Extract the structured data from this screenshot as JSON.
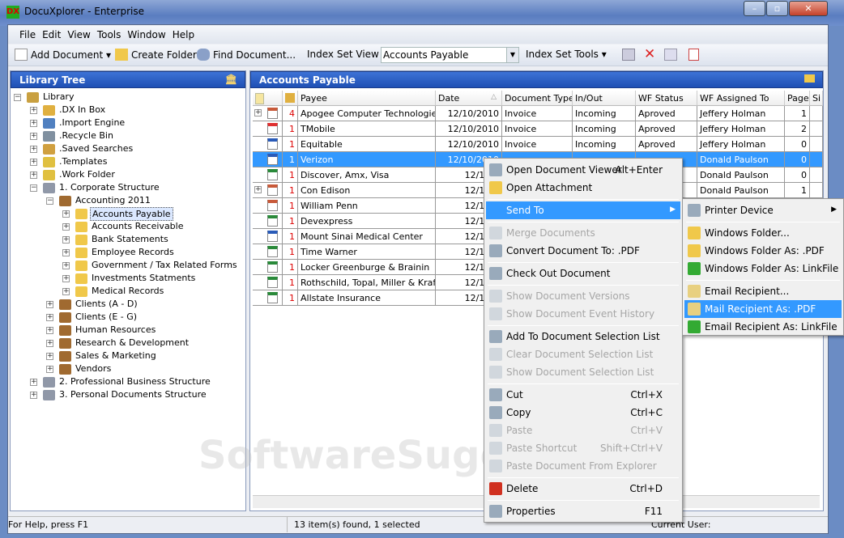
{
  "window": {
    "title": "DocuXplorer - Enterprise",
    "logo": "DX",
    "controls": [
      "–",
      "▫",
      "✕"
    ]
  },
  "menubar": [
    "File",
    "Edit",
    "View",
    "Tools",
    "Window",
    "Help"
  ],
  "toolbar": {
    "add_document": "Add Document",
    "create_folder": "Create Folder",
    "find_document": "Find Document...",
    "index_set_view_label": "Index Set View",
    "index_set_view_value": "Accounts Payable",
    "index_set_tools": "Index Set Tools"
  },
  "library_tree": {
    "title": "Library Tree",
    "items": [
      {
        "label": "Library",
        "level": 0,
        "icon": "library"
      },
      {
        "label": ".DX In Box",
        "level": 1,
        "icon": "inbox"
      },
      {
        "label": ".Import Engine",
        "level": 1,
        "icon": "gear"
      },
      {
        "label": ".Recycle Bin",
        "level": 1,
        "icon": "bin"
      },
      {
        "label": ".Saved Searches",
        "level": 1,
        "icon": "search"
      },
      {
        "label": ".Templates",
        "level": 1,
        "icon": "template"
      },
      {
        "label": ".Work Folder",
        "level": 1,
        "icon": "work"
      },
      {
        "label": "1. Corporate Structure",
        "level": 1,
        "icon": "cabinet",
        "open": true
      },
      {
        "label": "Accounting 2011",
        "level": 2,
        "icon": "drawer",
        "open": true
      },
      {
        "label": "Accounts Payable",
        "level": 3,
        "icon": "folder",
        "selected": true
      },
      {
        "label": "Accounts Receivable",
        "level": 3,
        "icon": "folder"
      },
      {
        "label": "Bank Statements",
        "level": 3,
        "icon": "folder"
      },
      {
        "label": "Employee Records",
        "level": 3,
        "icon": "folder"
      },
      {
        "label": "Government / Tax Related Forms",
        "level": 3,
        "icon": "folder"
      },
      {
        "label": "Investments Statments",
        "level": 3,
        "icon": "folder"
      },
      {
        "label": "Medical Records",
        "level": 3,
        "icon": "folder"
      },
      {
        "label": "Clients (A - D)",
        "level": 2,
        "icon": "drawer"
      },
      {
        "label": "Clients (E - G)",
        "level": 2,
        "icon": "drawer"
      },
      {
        "label": "Human Resources",
        "level": 2,
        "icon": "drawer"
      },
      {
        "label": "Research & Development",
        "level": 2,
        "icon": "drawer"
      },
      {
        "label": "Sales & Marketing",
        "level": 2,
        "icon": "drawer"
      },
      {
        "label": "Vendors",
        "level": 2,
        "icon": "drawer"
      },
      {
        "label": "2. Professional Business Structure",
        "level": 1,
        "icon": "cabinet"
      },
      {
        "label": "3. Personal Documents Structure",
        "level": 1,
        "icon": "cabinet"
      }
    ]
  },
  "documents": {
    "title": "Accounts Payable",
    "columns": [
      "Payee",
      "Date",
      "Document Type",
      "In/Out",
      "WF Status",
      "WF Assigned To",
      "Page",
      "Si"
    ],
    "rows": [
      {
        "type": "img",
        "exp": true,
        "count": "4",
        "payee": "Apogee Computer Technologies",
        "date": "12/10/2010",
        "doctype": "Invoice",
        "inout": "Incoming",
        "status": "Aproved",
        "assigned": "Jeffery Holman",
        "page": "1"
      },
      {
        "type": "pdf",
        "count": "1",
        "payee": "TMobile",
        "date": "12/10/2010",
        "doctype": "Invoice",
        "inout": "Incoming",
        "status": "Aproved",
        "assigned": "Jeffery Holman",
        "page": "2"
      },
      {
        "type": "word",
        "count": "1",
        "payee": "Equitable",
        "date": "12/10/2010",
        "doctype": "Invoice",
        "inout": "Incoming",
        "status": "Aproved",
        "assigned": "Jeffery Holman",
        "page": "0"
      },
      {
        "type": "word",
        "count": "1",
        "payee": "Verizon",
        "date": "12/10/2010",
        "doctype": "",
        "inout": "",
        "status": "",
        "assigned": "Donald Paulson",
        "page": "0",
        "selected": true
      },
      {
        "type": "excel",
        "count": "1",
        "payee": "Discover, Amx, Visa",
        "date": "12/10/2",
        "doctype": "",
        "inout": "",
        "status": "",
        "assigned": "Donald Paulson",
        "page": "0"
      },
      {
        "type": "img",
        "exp": true,
        "count": "1",
        "payee": "Con Edison",
        "date": "12/10/2",
        "doctype": "",
        "inout": "",
        "status": "",
        "assigned": "Donald Paulson",
        "page": "1"
      },
      {
        "type": "img",
        "count": "1",
        "payee": "William Penn",
        "date": "12/10/2",
        "doctype": "",
        "inout": "",
        "status": "",
        "assigned": "",
        "page": ""
      },
      {
        "type": "excel",
        "count": "1",
        "payee": "Devexpress",
        "date": "12/10/2",
        "doctype": "",
        "inout": "",
        "status": "",
        "assigned": "",
        "page": ""
      },
      {
        "type": "word",
        "count": "1",
        "payee": "Mount Sinai Medical Center",
        "date": "12/10/2",
        "doctype": "",
        "inout": "",
        "status": "",
        "assigned": "",
        "page": ""
      },
      {
        "type": "excel",
        "count": "1",
        "payee": "Time Warner",
        "date": "12/10/2",
        "doctype": "",
        "inout": "",
        "status": "",
        "assigned": "",
        "page": ""
      },
      {
        "type": "excel",
        "count": "1",
        "payee": "Locker Greenburge & Brainin",
        "date": "12/10/2",
        "doctype": "",
        "inout": "",
        "status": "",
        "assigned": "",
        "page": ""
      },
      {
        "type": "excel",
        "count": "1",
        "payee": "Rothschild, Topal, Miller & Kraft",
        "date": "12/10/2",
        "doctype": "",
        "inout": "",
        "status": "",
        "assigned": "",
        "page": ""
      },
      {
        "type": "excel",
        "count": "1",
        "payee": "Allstate Insurance",
        "date": "12/10/2",
        "doctype": "",
        "inout": "",
        "status": "",
        "assigned": "",
        "page": ""
      }
    ]
  },
  "context_menu": [
    {
      "label": "Open Document Viewer",
      "key": "Alt+Enter",
      "icon": "viewer"
    },
    {
      "label": "Open Attachment",
      "icon": "folder-open"
    },
    {
      "sep": true
    },
    {
      "label": "Send To",
      "submenu": true,
      "highlight": true
    },
    {
      "sep": true
    },
    {
      "label": "Merge Documents",
      "disabled": true,
      "icon": "merge"
    },
    {
      "label": "Convert Document To: .PDF",
      "icon": "convert"
    },
    {
      "sep": true
    },
    {
      "label": "Check Out Document",
      "icon": "checkout"
    },
    {
      "sep": true
    },
    {
      "label": "Show Document Versions",
      "disabled": true,
      "icon": "versions"
    },
    {
      "label": "Show Document Event History",
      "disabled": true,
      "icon": "history"
    },
    {
      "sep": true
    },
    {
      "label": "Add To Document Selection List",
      "icon": "add-list"
    },
    {
      "label": "Clear Document Selection List",
      "disabled": true,
      "icon": "clear-list"
    },
    {
      "label": "Show Document Selection List",
      "disabled": true,
      "icon": "show-list"
    },
    {
      "sep": true
    },
    {
      "label": "Cut",
      "key": "Ctrl+X",
      "icon": "scissors"
    },
    {
      "label": "Copy",
      "key": "Ctrl+C",
      "icon": "copy"
    },
    {
      "label": "Paste",
      "key": "Ctrl+V",
      "disabled": true,
      "icon": "paste"
    },
    {
      "label": "Paste Shortcut",
      "key": "Shift+Ctrl+V",
      "disabled": true,
      "icon": "paste"
    },
    {
      "label": "Paste Document From Explorer",
      "disabled": true,
      "icon": "paste"
    },
    {
      "sep": true
    },
    {
      "label": "Delete",
      "key": "Ctrl+D",
      "icon": "delete"
    },
    {
      "sep": true
    },
    {
      "label": "Properties",
      "key": "F11",
      "icon": "properties"
    }
  ],
  "send_to_menu": [
    {
      "label": "Printer Device",
      "submenu": true,
      "icon": "printer"
    },
    {
      "sep": true
    },
    {
      "label": "Windows Folder...",
      "icon": "folder"
    },
    {
      "label": "Windows Folder As: .PDF",
      "icon": "folder"
    },
    {
      "label": "Windows Folder As: LinkFile",
      "icon": "dx"
    },
    {
      "sep": true
    },
    {
      "label": "Email Recipient...",
      "icon": "mail"
    },
    {
      "label": "Mail Recipient As: .PDF",
      "icon": "mail",
      "highlight": true
    },
    {
      "label": "Email Recipient As: LinkFile",
      "icon": "dx"
    }
  ],
  "status": {
    "help": "For Help, press F1",
    "count": "13 item(s) found, 1 selected",
    "user": "Current User:"
  },
  "watermark": "SoftwareSuggest.com"
}
